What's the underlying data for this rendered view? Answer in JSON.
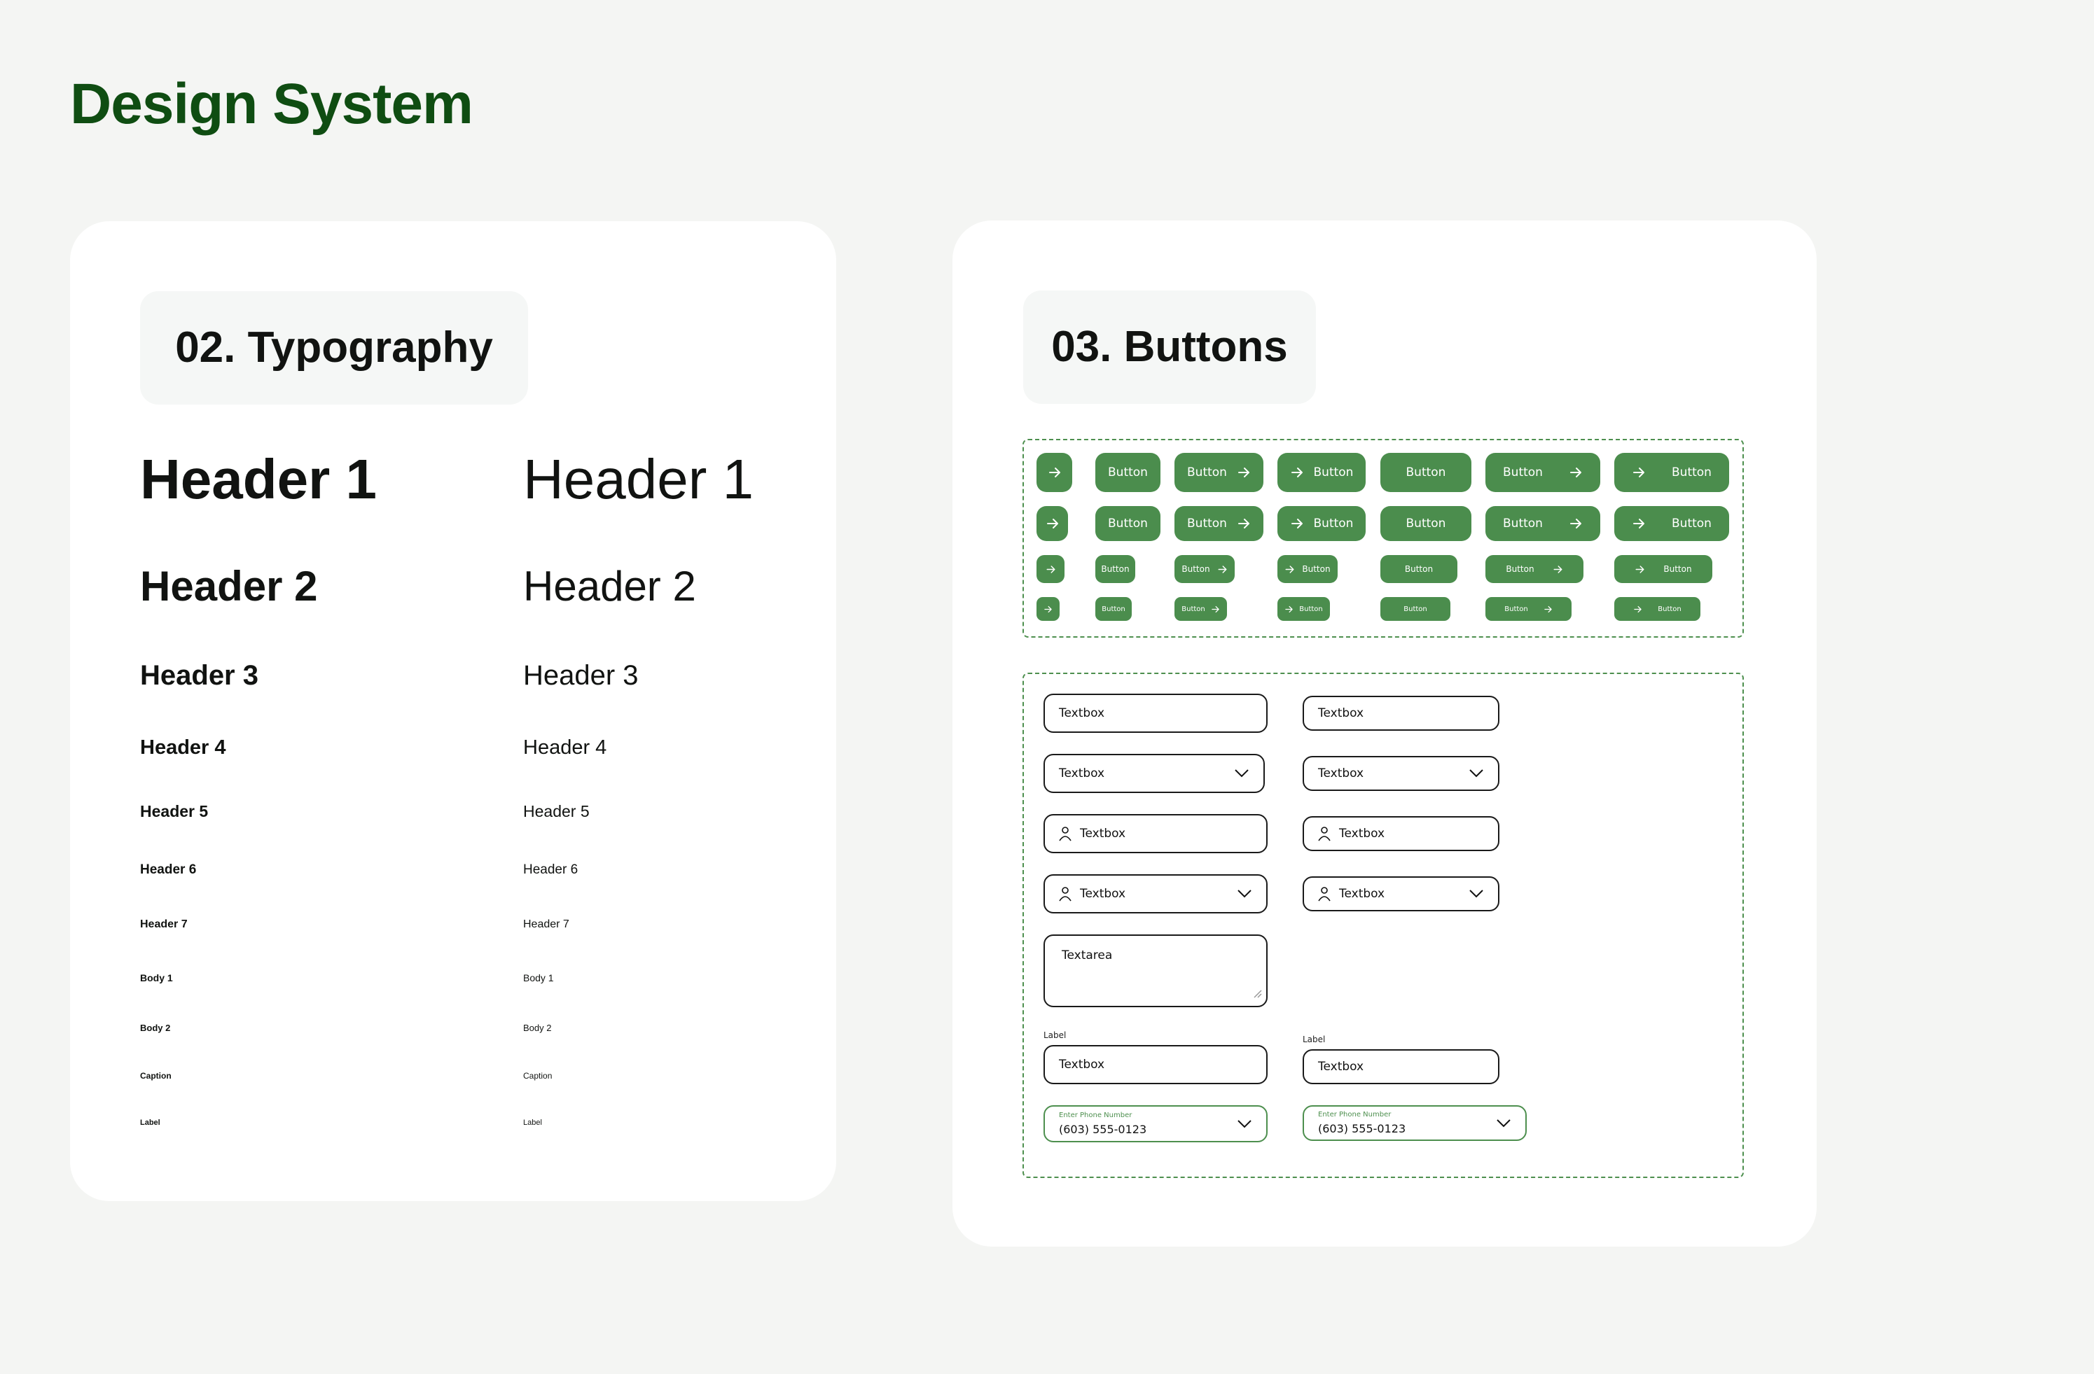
{
  "page": {
    "title": "Design System",
    "title_color": "#0f4d12",
    "background": "#f4f5f3"
  },
  "typography": {
    "section_title": "02. Typography",
    "styles": [
      {
        "name": "Header 1",
        "bold": "Header 1",
        "regular": "Header 1"
      },
      {
        "name": "Header 2",
        "bold": "Header 2",
        "regular": "Header 2"
      },
      {
        "name": "Header 3",
        "bold": "Header 3",
        "regular": "Header 3"
      },
      {
        "name": "Header 4",
        "bold": "Header 4",
        "regular": "Header 4"
      },
      {
        "name": "Header 5",
        "bold": "Header 5",
        "regular": "Header 5"
      },
      {
        "name": "Header 6",
        "bold": "Header 6",
        "regular": "Header 6"
      },
      {
        "name": "Header 7",
        "bold": "Header 7",
        "regular": "Header 7"
      },
      {
        "name": "Body 1",
        "bold": "Body 1",
        "regular": "Body 1"
      },
      {
        "name": "Body 2",
        "bold": "Body 2",
        "regular": "Body 2"
      },
      {
        "name": "Caption",
        "bold": "Caption",
        "regular": "Caption"
      },
      {
        "name": "Label",
        "bold": "Label",
        "regular": "Label"
      }
    ]
  },
  "buttons": {
    "section_title": "03. Buttons",
    "accent_color": "#4b8d4d",
    "button_label": "Button",
    "arrow_icon": "arrow-right-icon",
    "sizes": [
      "xl",
      "lg",
      "md",
      "sm"
    ],
    "variants": [
      "icon-only",
      "label",
      "label-trailing-icon",
      "leading-icon-label",
      "label-wide",
      "label-trailing-icon-wide",
      "leading-icon-label-wide"
    ]
  },
  "inputs": {
    "border_color": "#1a1a1a",
    "accent_color": "#4d8f4e",
    "textbox_value": "Textbox",
    "textarea_value": "Textarea",
    "field_label": "Label",
    "phone": {
      "placeholder": "Enter Phone Number",
      "value": "(603) 555-0123"
    },
    "icons": {
      "user": "user-icon",
      "chevron": "chevron-down-icon",
      "resize": "resize-handle-icon"
    }
  }
}
